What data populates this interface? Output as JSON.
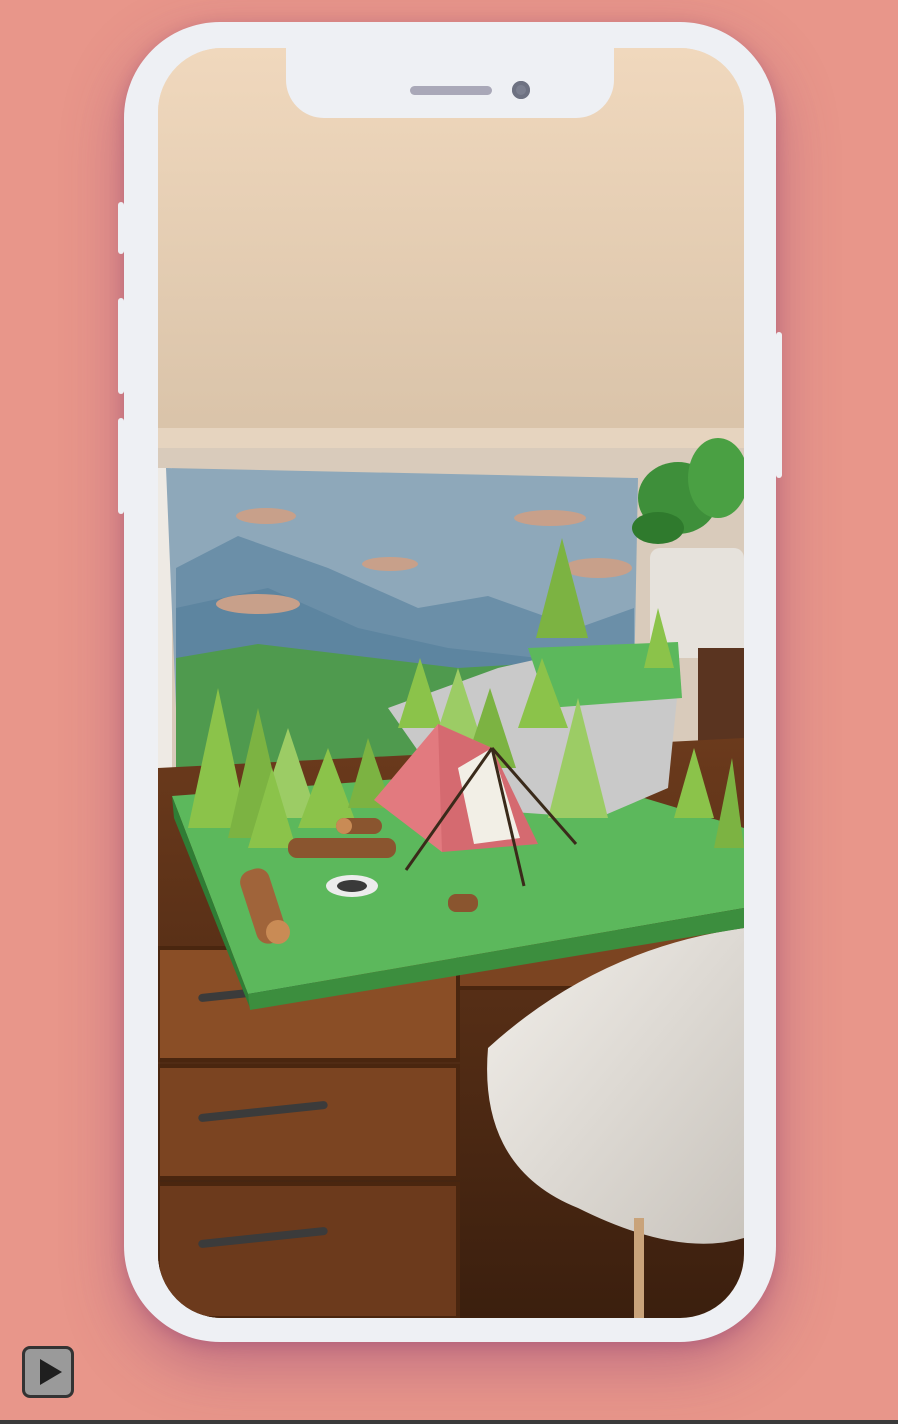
{
  "scene": {
    "description_icon": "ar-camping-diorama",
    "colors": {
      "background": "#e8968a",
      "phone_frame": "#eef0f4",
      "tent": "#e27a7f",
      "grass": "#5cb85c",
      "sky": "#8ba6b8",
      "wood": "#7a4a28"
    }
  },
  "controls": {
    "play_icon": "play-icon"
  }
}
